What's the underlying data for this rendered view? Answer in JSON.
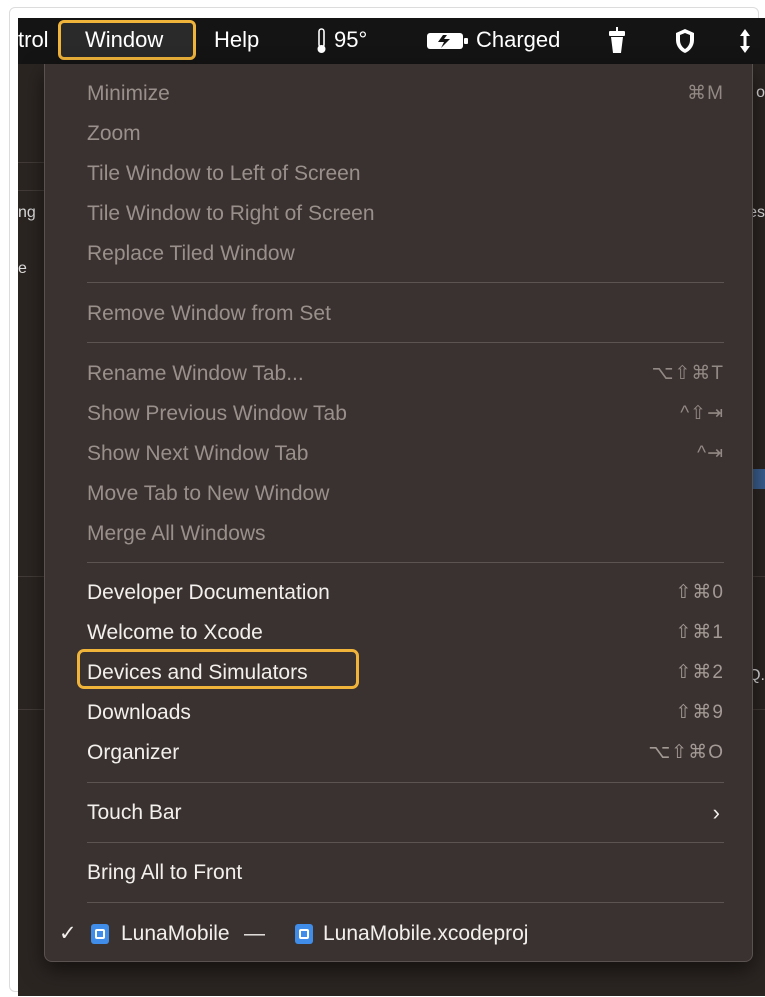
{
  "menubar": {
    "left_fragment": "trol",
    "window_menu": "Window",
    "help_menu": "Help",
    "temperature": "95°",
    "battery_status": "Charged"
  },
  "background": {
    "frag1": "ng",
    "frag2": "e",
    "frag3": "o",
    "frag4": "es",
    "frag5": "Q."
  },
  "menu": {
    "group1": [
      {
        "label": "Minimize",
        "shortcut": "⌘M"
      },
      {
        "label": "Zoom",
        "shortcut": ""
      },
      {
        "label": "Tile Window to Left of Screen",
        "shortcut": ""
      },
      {
        "label": "Tile Window to Right of Screen",
        "shortcut": ""
      },
      {
        "label": "Replace Tiled Window",
        "shortcut": ""
      }
    ],
    "group2": [
      {
        "label": "Remove Window from Set",
        "shortcut": ""
      }
    ],
    "group3": [
      {
        "label": "Rename Window Tab...",
        "shortcut": "⌥⇧⌘T"
      },
      {
        "label": "Show Previous Window Tab",
        "shortcut": "^⇧⇥"
      },
      {
        "label": "Show Next Window Tab",
        "shortcut": "^⇥"
      },
      {
        "label": "Move Tab to New Window",
        "shortcut": ""
      },
      {
        "label": "Merge All Windows",
        "shortcut": ""
      }
    ],
    "group4": [
      {
        "label": "Developer Documentation",
        "shortcut": "⇧⌘0"
      },
      {
        "label": "Welcome to Xcode",
        "shortcut": "⇧⌘1"
      },
      {
        "label": "Devices and Simulators",
        "shortcut": "⇧⌘2"
      },
      {
        "label": "Downloads",
        "shortcut": "⇧⌘9"
      },
      {
        "label": "Organizer",
        "shortcut": "⌥⇧⌘O"
      }
    ],
    "touch_bar": "Touch Bar",
    "bring_all": "Bring All to Front",
    "window_entry": {
      "project": "LunaMobile",
      "dash": "—",
      "file": "LunaMobile.xcodeproj"
    }
  },
  "colors": {
    "highlight": "#f0b43a",
    "menu_bg": "#3a3230",
    "menubar_bg": "#141414"
  }
}
